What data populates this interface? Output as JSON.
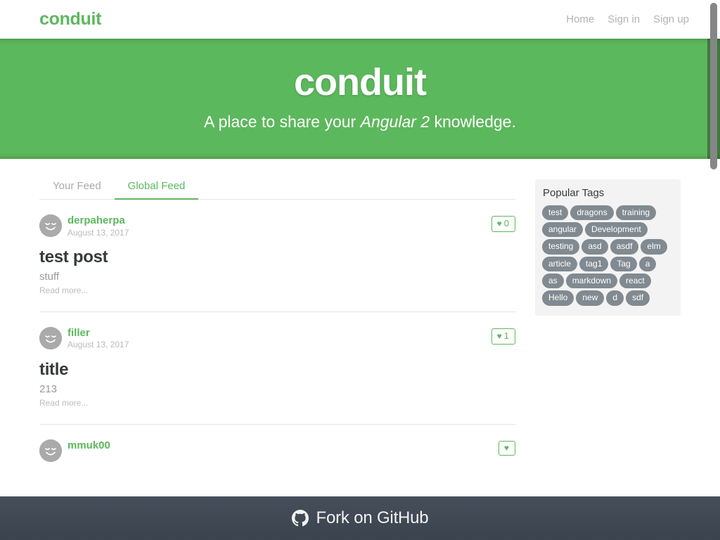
{
  "navbar": {
    "brand": "conduit",
    "links": [
      {
        "label": "Home",
        "name": "nav-link-home"
      },
      {
        "label": "Sign in",
        "name": "nav-link-sign-in"
      },
      {
        "label": "Sign up",
        "name": "nav-link-sign-up"
      }
    ]
  },
  "banner": {
    "title": "conduit",
    "subtitle_prefix": "A place to share your ",
    "subtitle_em": "Angular 2",
    "subtitle_suffix": " knowledge.",
    "background_color": "#5CB85C"
  },
  "feed": {
    "tabs": [
      {
        "label": "Your Feed",
        "active": false
      },
      {
        "label": "Global Feed",
        "active": true
      }
    ],
    "articles": [
      {
        "author": "derpaherpa",
        "date": "August 13, 2017",
        "title": "test post",
        "description": "stuff",
        "read_more": "Read more...",
        "favorites_count": "0",
        "avatar": "smiley-avatar"
      },
      {
        "author": "filler",
        "date": "August 13, 2017",
        "title": "title",
        "description": "213",
        "read_more": "Read more...",
        "favorites_count": "1",
        "avatar": "smiley-avatar"
      },
      {
        "author": "mmuk00",
        "date": "",
        "title": "",
        "description": "",
        "read_more": "",
        "favorites_count": "",
        "avatar": "smiley-avatar"
      }
    ]
  },
  "sidebar": {
    "title": "Popular Tags",
    "tags": [
      "test",
      "dragons",
      "training",
      "angular",
      "Development",
      "testing",
      "asd",
      "asdf",
      "elm",
      "article",
      "tag1",
      "Tag",
      "a",
      "as",
      "markdown",
      "react",
      "Hello",
      "new",
      "d",
      "sdf"
    ]
  },
  "footer": {
    "label": "Fork on GitHub",
    "icon": "github-icon"
  },
  "colors": {
    "brand_green": "#5CB85C",
    "tag_gray": "#818a91",
    "footer_dark": "#454f5b"
  }
}
